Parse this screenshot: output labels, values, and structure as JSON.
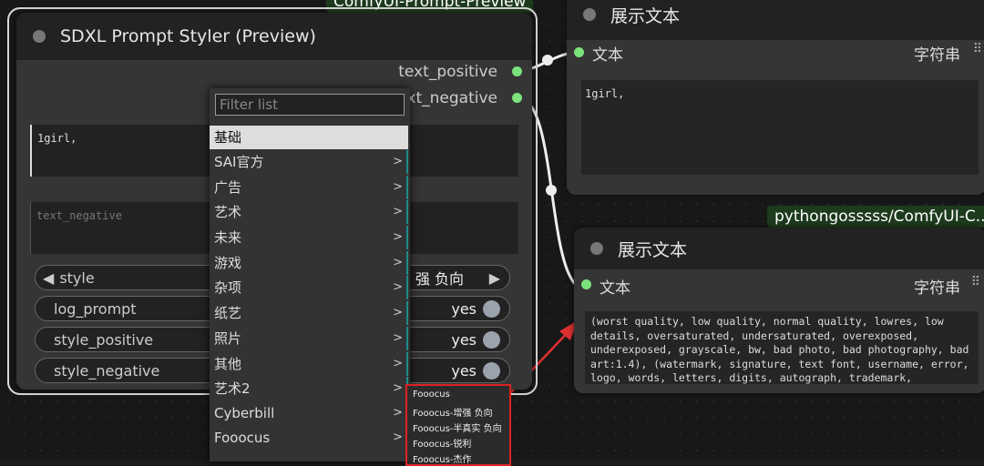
{
  "canvas": {
    "background": "#181818"
  },
  "top_tag": "ComfyUI-Prompt-Preview",
  "styler": {
    "title": "SDXL Prompt Styler (Preview)",
    "outputs": [
      "text_positive",
      "text_negative"
    ],
    "positive_text": "1girl,",
    "negative_placeholder": "text_negative",
    "style_label": "style",
    "style_value": "强 负向",
    "toggles": [
      {
        "label": "log_prompt",
        "value": "yes"
      },
      {
        "label": "style_positive",
        "value": "yes"
      },
      {
        "label": "style_negative",
        "value": "yes"
      }
    ]
  },
  "menu": {
    "filter_placeholder": "Filter list",
    "items": [
      "基础",
      "SAI官方",
      "广告",
      "艺术",
      "未来",
      "游戏",
      "杂项",
      "纸艺",
      "照片",
      "其他",
      "艺术2",
      "Cyberbill",
      "Fooocus"
    ],
    "arrow": ">"
  },
  "submenu": {
    "items": [
      "Fooocus",
      "Fooocus-增强 负向",
      "Fooocus-半真实 负向",
      "Fooocus-锐利",
      "Fooocus-杰作"
    ]
  },
  "display1": {
    "title": "展示文本",
    "input_label": "文本",
    "type_label": "字符串",
    "text": "1girl,"
  },
  "display2": {
    "tag": "pythongosssss/ComfyUI-C..",
    "title": "展示文本",
    "input_label": "文本",
    "type_label": "字符串",
    "text": "(worst quality, low quality, normal quality, lowres, low details, oversaturated, undersaturated, overexposed, underexposed, grayscale, bw, bad photo, bad photography, bad art:1.4), (watermark, signature, text font, username, error, logo, words, letters, digits, autograph, trademark,"
  },
  "colors": {
    "socket": "#7ce27c",
    "highlight_border": "#dd2222",
    "accent_line": "#1a8a8a"
  }
}
